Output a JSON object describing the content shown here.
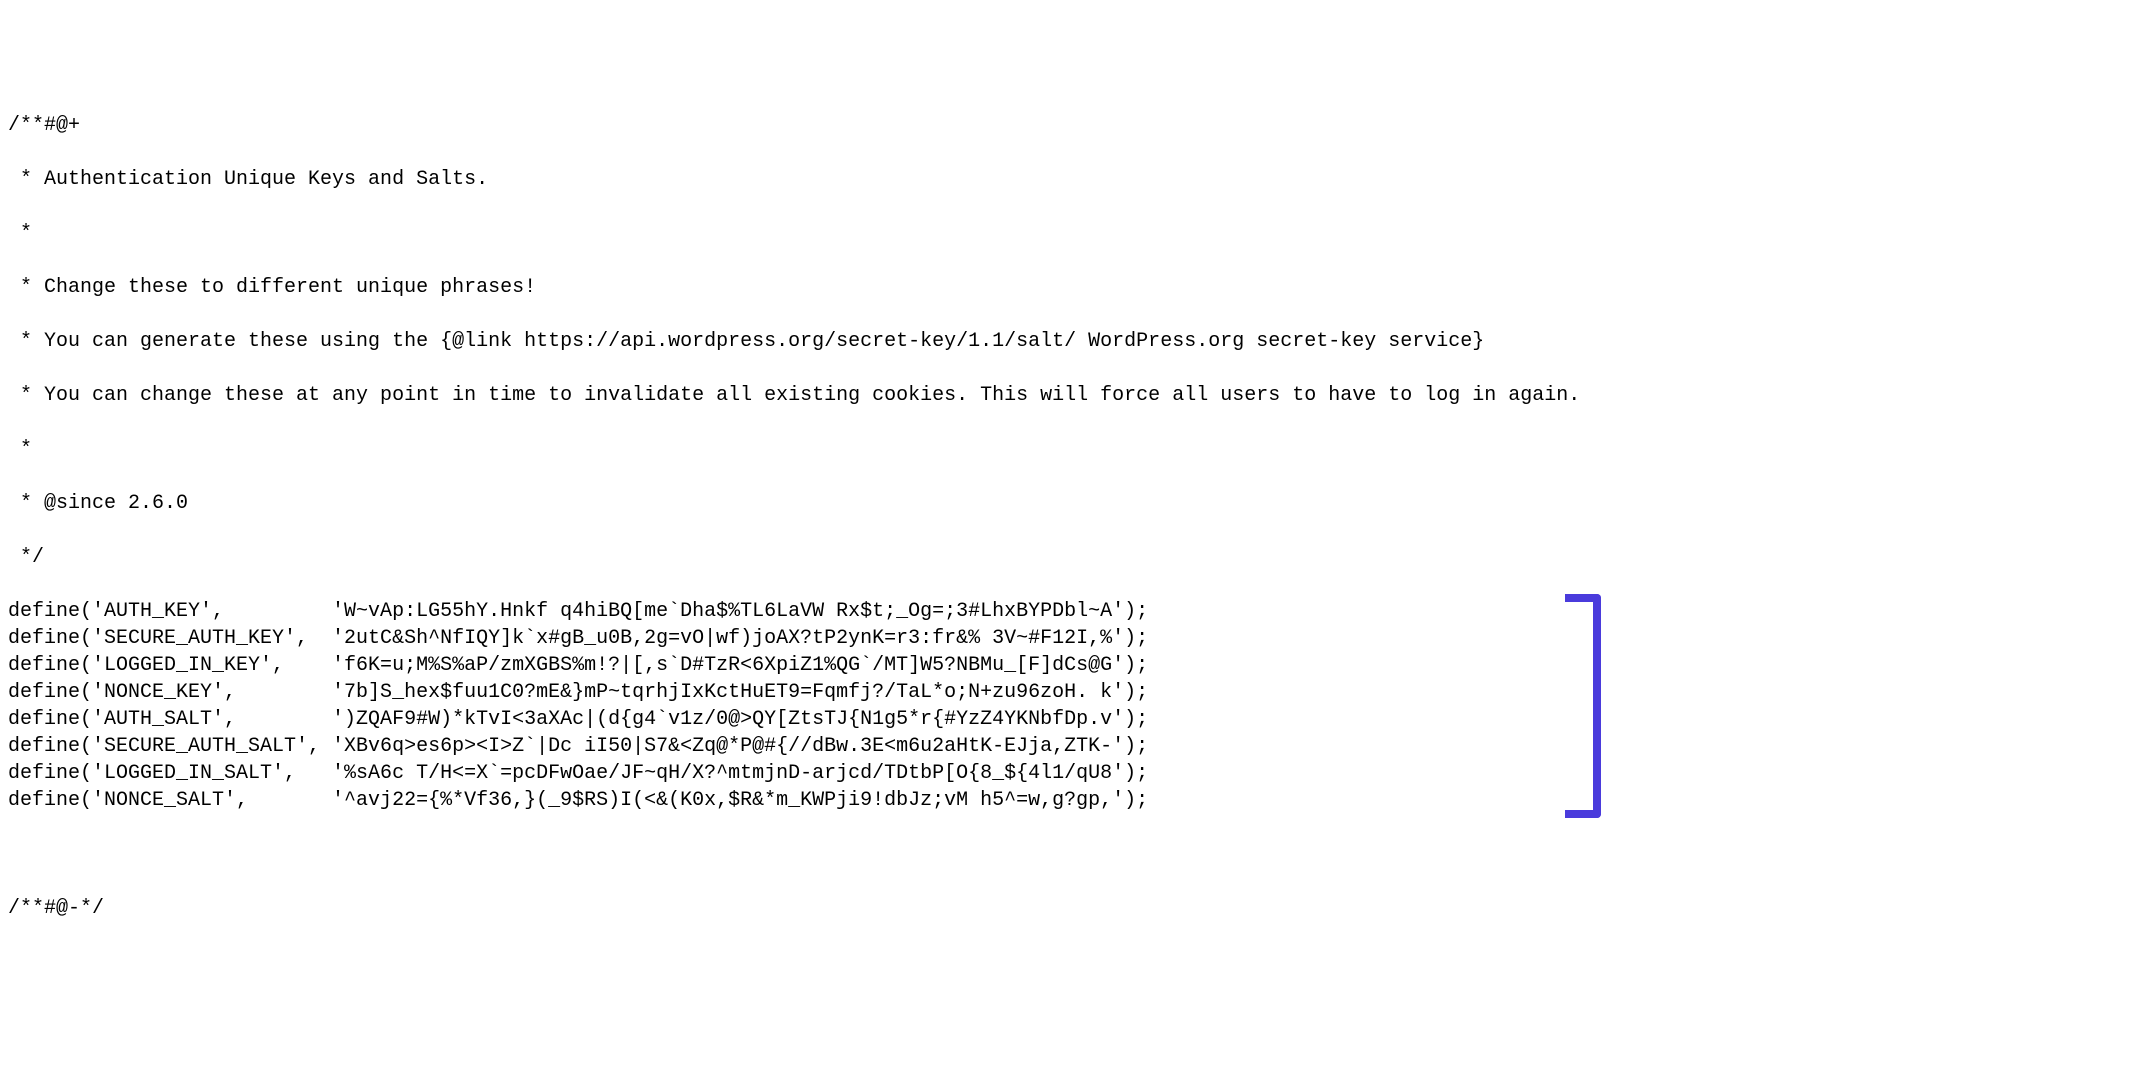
{
  "comment": {
    "l1": "/**#@+",
    "l2": " * Authentication Unique Keys and Salts.",
    "l3": " *",
    "l4": " * Change these to different unique phrases!",
    "l5": " * You can generate these using the {@link https://api.wordpress.org/secret-key/1.1/salt/ WordPress.org secret-key service}",
    "l6": " * You can change these at any point in time to invalidate all existing cookies. This will force all users to have to log in again.",
    "l7": " *",
    "l8": " * @since 2.6.0",
    "l9": " */"
  },
  "defines": [
    {
      "line": "define('AUTH_KEY',         'W~vAp:LG55hY.Hnkf q4hiBQ[me`Dha$%TL6LaVW Rx$t;_Og=;3#LhxBYPDbl~A');"
    },
    {
      "line": "define('SECURE_AUTH_KEY',  '2utC&Sh^NfIQY]k`x#gB_u0B,2g=vO|wf)joAX?tP2ynK=r3:fr&% 3V~#F12I,%');"
    },
    {
      "line": "define('LOGGED_IN_KEY',    'f6K=u;M%S%aP/zmXGBS%m!?|[,s`D#TzR<6XpiZ1%QG`/MT]W5?NBMu_[F]dCs@G');"
    },
    {
      "line": "define('NONCE_KEY',        '7b]S_hex$fuu1C0?mE&}mP~tqrhjIxKctHuET9=Fqmfj?/TaL*o;N+zu96zoH. k');"
    },
    {
      "line": "define('AUTH_SALT',        ')ZQAF9#W)*kTvI<3aXAc|(d{g4`v1z/0@>QY[ZtsTJ{N1g5*r{#YzZ4YKNbfDp.v');"
    },
    {
      "line": "define('SECURE_AUTH_SALT', 'XBv6q>es6p><I>Z`|Dc iI50|S7&<Zq@*P@#{//dBw.3E<m6u2aHtK-EJja,ZTK-');"
    },
    {
      "line": "define('LOGGED_IN_SALT',   '%sA6c T/H<=X`=pcDFwOae/JF~qH/X?^mtmjnD-arjcd/TDtbP[O{8_${4l1/qU8');"
    },
    {
      "line": "define('NONCE_SALT',       '^avj22={%*Vf36,}(_9$RS)I(<&(K0x,$R&*m_KWPji9!dbJz;vM h5^=w,g?gp,');"
    }
  ],
  "closer": "/**#@-*/"
}
